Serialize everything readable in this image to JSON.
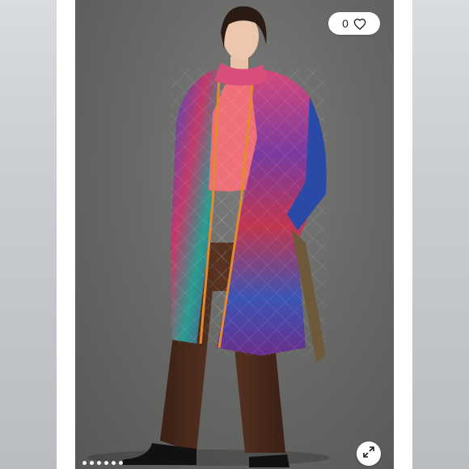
{
  "listing": {
    "like_count": "0",
    "heart_icon": "heart-outline-icon",
    "expand_icon": "expand-arrows-icon",
    "photo_count": 6,
    "current_photo_index": 1
  },
  "colors": {
    "backdrop": "#696967",
    "coat_pink": "#e25a7a",
    "coat_blue": "#2e3f9a",
    "sweater": "#ef6f78",
    "pants": "#4b2a1c",
    "trim": "#e38a2f"
  }
}
